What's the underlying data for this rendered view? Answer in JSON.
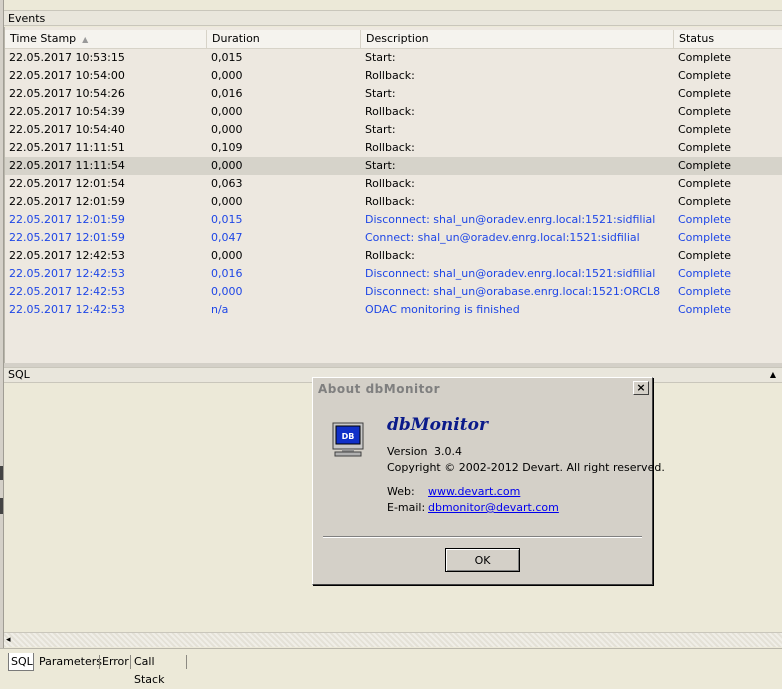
{
  "events": {
    "header": "Events",
    "columns": [
      "Time Stamp",
      "Duration",
      "Description",
      "Status"
    ],
    "rows": [
      {
        "time": "22.05.2017 10:53:15",
        "duration": "0,015",
        "description": "Start:",
        "status": "Complete",
        "style": "normal"
      },
      {
        "time": "22.05.2017 10:54:00",
        "duration": "0,000",
        "description": "Rollback:",
        "status": "Complete",
        "style": "normal"
      },
      {
        "time": "22.05.2017 10:54:26",
        "duration": "0,016",
        "description": "Start:",
        "status": "Complete",
        "style": "normal"
      },
      {
        "time": "22.05.2017 10:54:39",
        "duration": "0,000",
        "description": "Rollback:",
        "status": "Complete",
        "style": "normal"
      },
      {
        "time": "22.05.2017 10:54:40",
        "duration": "0,000",
        "description": "Start:",
        "status": "Complete",
        "style": "normal"
      },
      {
        "time": "22.05.2017 11:11:51",
        "duration": "0,109",
        "description": "Rollback:",
        "status": "Complete",
        "style": "normal"
      },
      {
        "time": "22.05.2017 11:11:54",
        "duration": "0,000",
        "description": "Start:",
        "status": "Complete",
        "style": "selected"
      },
      {
        "time": "22.05.2017 12:01:54",
        "duration": "0,063",
        "description": "Rollback:",
        "status": "Complete",
        "style": "normal"
      },
      {
        "time": "22.05.2017 12:01:59",
        "duration": "0,000",
        "description": "Rollback:",
        "status": "Complete",
        "style": "normal"
      },
      {
        "time": "22.05.2017 12:01:59",
        "duration": "0,015",
        "description": "Disconnect: shal_un@oradev.enrg.local:1521:sidfilial",
        "status": "Complete",
        "style": "blue"
      },
      {
        "time": "22.05.2017 12:01:59",
        "duration": "0,047",
        "description": "Connect: shal_un@oradev.enrg.local:1521:sidfilial",
        "status": "Complete",
        "style": "blue"
      },
      {
        "time": "22.05.2017 12:42:53",
        "duration": "0,000",
        "description": "Rollback:",
        "status": "Complete",
        "style": "normal"
      },
      {
        "time": "22.05.2017 12:42:53",
        "duration": "0,016",
        "description": "Disconnect: shal_un@oradev.enrg.local:1521:sidfilial",
        "status": "Complete",
        "style": "blue"
      },
      {
        "time": "22.05.2017 12:42:53",
        "duration": "0,000",
        "description": "Disconnect: shal_un@orabase.enrg.local:1521:ORCL8",
        "status": "Complete",
        "style": "blue"
      },
      {
        "time": "22.05.2017 12:42:53",
        "duration": "n/a",
        "description": "ODAC monitoring is finished",
        "status": "Complete",
        "style": "blue"
      }
    ]
  },
  "sql": {
    "header": "SQL"
  },
  "tabs": [
    "SQL",
    "Parameters",
    "Error",
    "Call Stack"
  ],
  "dialog": {
    "title": "About dbMonitor",
    "close": "×",
    "icon_label": "DB",
    "app_name": "dbMonitor",
    "version_label": "Version",
    "version": "3.0.4",
    "copyright": "Copyright © 2002-2012 Devart. All right reserved.",
    "web_label": "Web:",
    "web_link": "www.devart.com",
    "email_label": "E-mail:",
    "email_link": "dbmonitor@devart.com",
    "ok": "OK"
  },
  "colors": {
    "link_row": "#1e46e6",
    "selected_row": "#d6d3ca",
    "app_name": "#0a1a8a"
  }
}
